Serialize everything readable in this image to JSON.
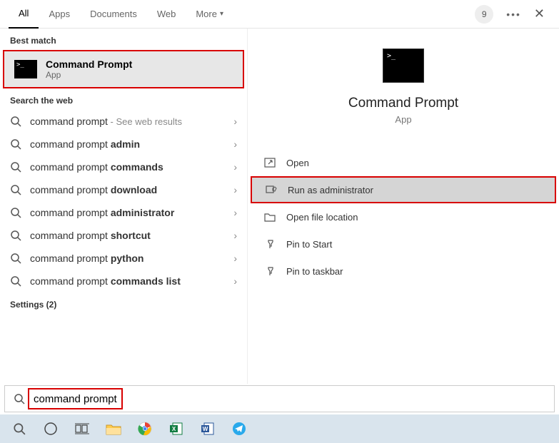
{
  "tabs": {
    "all": "All",
    "apps": "Apps",
    "documents": "Documents",
    "web": "Web",
    "more": "More"
  },
  "badge_count": "9",
  "sections": {
    "best_match": "Best match",
    "search_web": "Search the web",
    "settings": "Settings (2)"
  },
  "best_match": {
    "title": "Command Prompt",
    "subtitle": "App"
  },
  "web_results": [
    {
      "prefix": "command prompt",
      "bold": "",
      "suffix": " - See web results"
    },
    {
      "prefix": "command prompt ",
      "bold": "admin",
      "suffix": ""
    },
    {
      "prefix": "command prompt ",
      "bold": "commands",
      "suffix": ""
    },
    {
      "prefix": "command prompt ",
      "bold": "download",
      "suffix": ""
    },
    {
      "prefix": "command prompt ",
      "bold": "administrator",
      "suffix": ""
    },
    {
      "prefix": "command prompt ",
      "bold": "shortcut",
      "suffix": ""
    },
    {
      "prefix": "command prompt ",
      "bold": "python",
      "suffix": ""
    },
    {
      "prefix": "command prompt ",
      "bold": "commands list",
      "suffix": ""
    }
  ],
  "preview": {
    "title": "Command Prompt",
    "subtitle": "App"
  },
  "actions": {
    "open": "Open",
    "run_admin": "Run as administrator",
    "open_location": "Open file location",
    "pin_start": "Pin to Start",
    "pin_taskbar": "Pin to taskbar"
  },
  "search_query": "command prompt"
}
